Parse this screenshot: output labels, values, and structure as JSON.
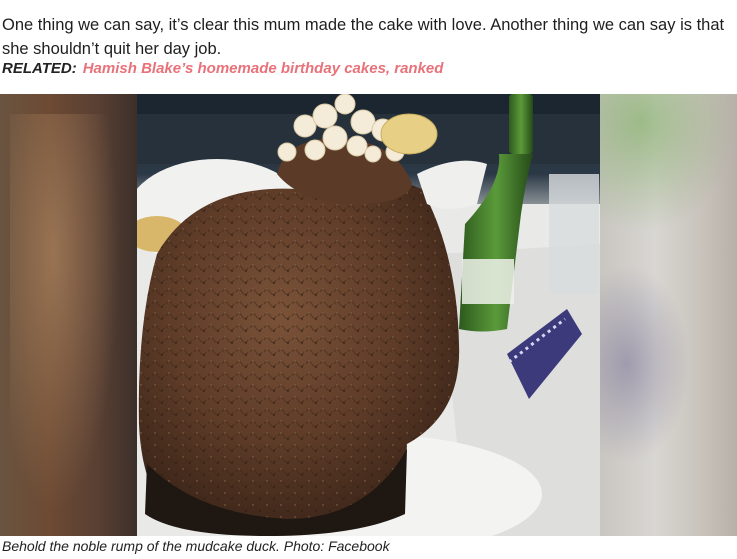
{
  "article": {
    "paragraph": "One thing we can say, it’s clear this mum made the cake with love. Another thing we can say is that she shouldn’t quit her day job.",
    "related_label": "RELATED:",
    "related_link": "Hamish Blake’s homemade birthday cakes, ranked"
  },
  "figure": {
    "caption": "Behold the noble rump of the mudcake duck. Photo: Facebook"
  },
  "colors": {
    "link": "#e8727a",
    "text": "#1e1e1e"
  }
}
